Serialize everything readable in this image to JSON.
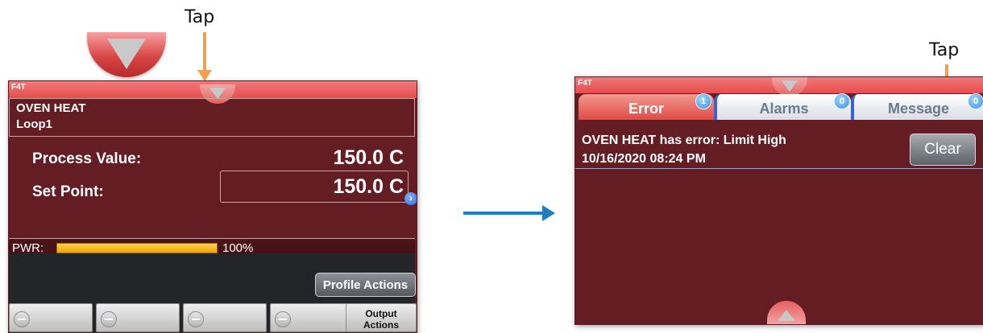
{
  "annotations": {
    "tap_left": "Tap",
    "tap_right": "Tap"
  },
  "home_screen": {
    "brand": "F4T",
    "loop": {
      "title": "OVEN HEAT",
      "subtitle": "Loop1"
    },
    "process_value": {
      "label": "Process Value:",
      "value": "150.0 C"
    },
    "set_point": {
      "label": "Set Point:",
      "value": "150.0 C"
    },
    "power": {
      "label": "PWR:",
      "value_text": "100%",
      "fraction": 1.0
    },
    "profile_actions_label": "Profile Actions",
    "softkeys": [
      {
        "label": "",
        "icon": "minus-circle-icon"
      },
      {
        "label": "",
        "icon": "minus-circle-icon"
      },
      {
        "label": "",
        "icon": "minus-circle-icon"
      },
      {
        "label": "",
        "icon": "minus-circle-icon"
      },
      {
        "label_line1": "Output",
        "label_line2": "Actions"
      }
    ]
  },
  "error_screen": {
    "brand": "F4T",
    "tabs": [
      {
        "label": "Error",
        "badge": "1",
        "active": true
      },
      {
        "label": "Alarms",
        "badge": "0",
        "active": false
      },
      {
        "label": "Message",
        "badge": "0",
        "active": false
      }
    ],
    "error": {
      "message": "OVEN HEAT has error: Limit High",
      "timestamp": "10/16/2020 08:24 PM"
    },
    "clear_label": "Clear"
  },
  "colors": {
    "screen_bg": "#641d22",
    "header_red": "#e64c4c",
    "annotation_arrow": "#f0a050",
    "flow_arrow": "#1f7ec3",
    "tab_badge_blue": "#3a8fe0"
  }
}
